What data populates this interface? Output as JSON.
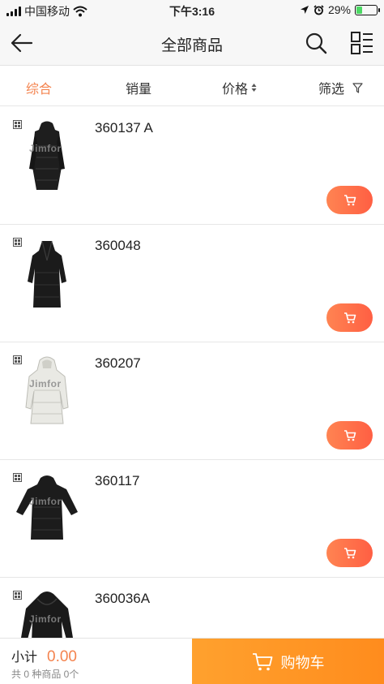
{
  "status_bar": {
    "carrier": "中国移动",
    "time": "下午3:16",
    "battery": "29%",
    "battery_level": 0.29
  },
  "nav": {
    "title": "全部商品"
  },
  "filters": {
    "tabs": [
      {
        "label": "综合"
      },
      {
        "label": "销量"
      },
      {
        "label": "价格"
      },
      {
        "label": "筛选"
      }
    ]
  },
  "products": [
    {
      "name": "360137 A",
      "watermark": "Jimfor"
    },
    {
      "name": "360048",
      "watermark": ""
    },
    {
      "name": "360207",
      "watermark": "Jimfor"
    },
    {
      "name": "360117",
      "watermark": "Jimfor"
    },
    {
      "name": "360036A",
      "watermark": "Jimfor"
    }
  ],
  "bottom_bar": {
    "subtotal_label": "小计",
    "subtotal_value": "0.00",
    "summary": "共 0 种商品 0个",
    "checkout_label": "购物车"
  },
  "colors": {
    "accent": "#f4834e",
    "checkout": "#ff9526",
    "cart_button": "#ff6a48"
  }
}
